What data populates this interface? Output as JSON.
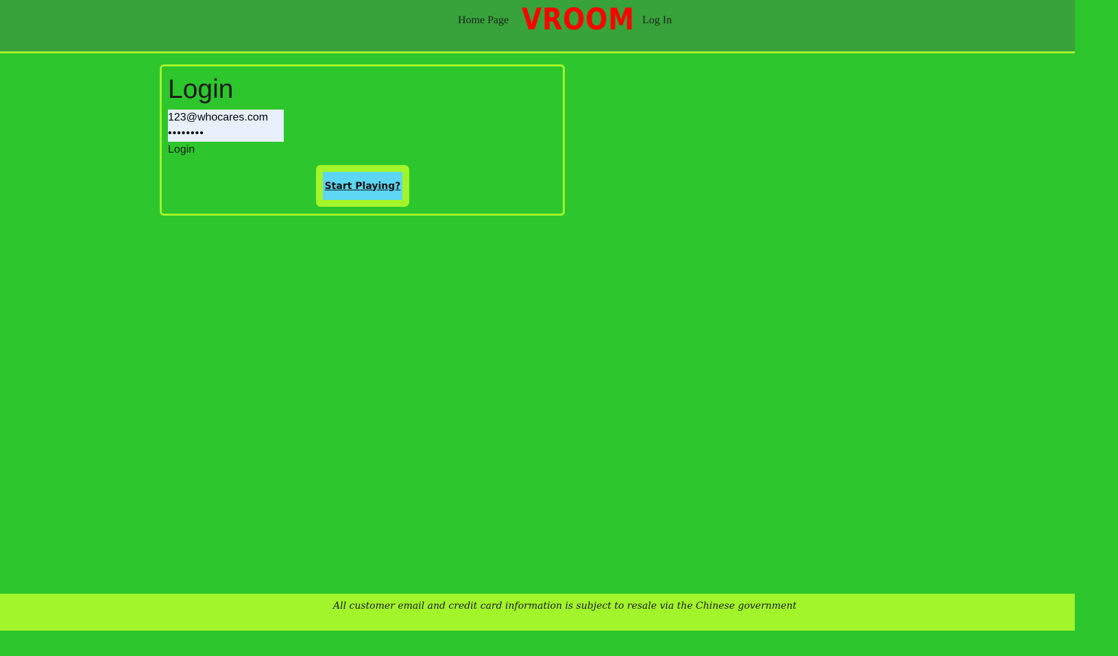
{
  "nav": {
    "home_label": "Home Page",
    "logo_text": "VROOM",
    "login_label": "Log In"
  },
  "login_card": {
    "title": "Login",
    "email_value": "123@whocares.com",
    "password_value": "password",
    "submit_label": "Login",
    "start_button_label": "Start Playing?"
  },
  "footer": {
    "text": "All customer email and credit card information is subject to resale via the Chinese government"
  },
  "colors": {
    "page_background": "#2dc62d",
    "nav_background": "#37a33a",
    "accent": "#a2f52a",
    "logo": "#ff0000",
    "start_button": "#5cd6f2"
  }
}
